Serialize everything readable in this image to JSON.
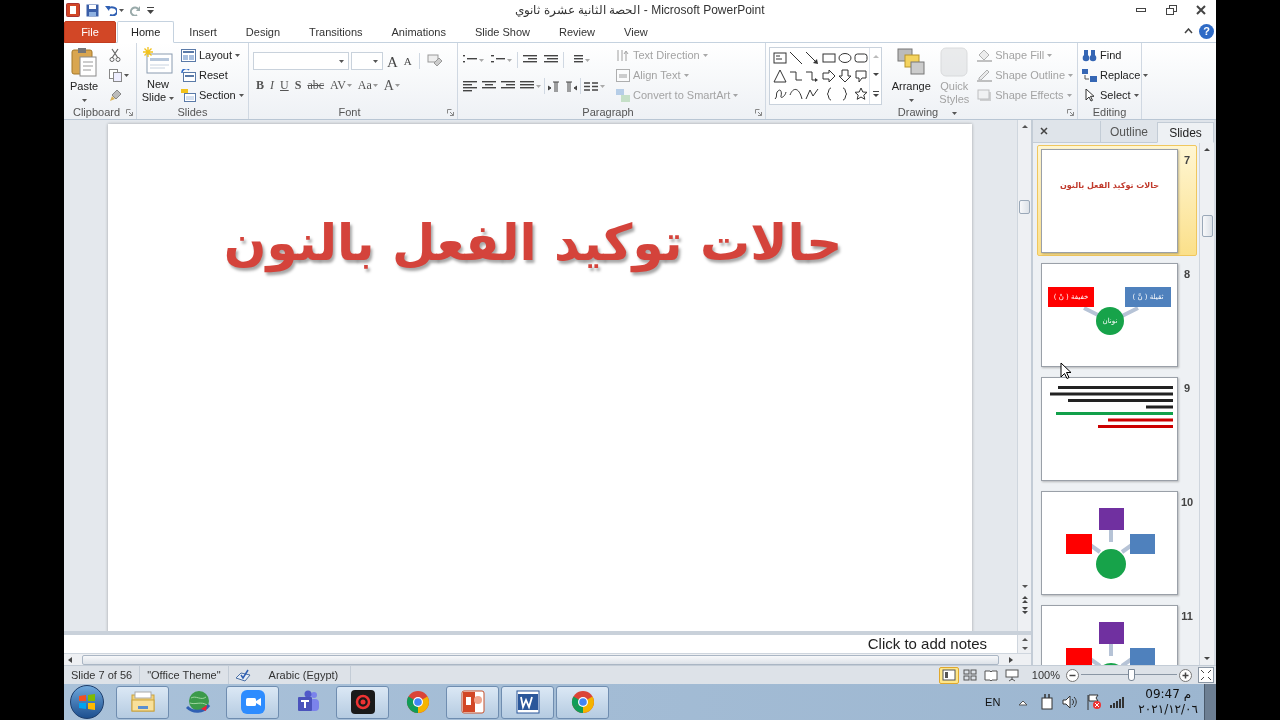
{
  "window": {
    "title": "الحصة الثانية عشرة ثانوي  -  Microsoft PowerPoint"
  },
  "ribbon_tabs": [
    {
      "label": "File",
      "kind": "file",
      "selected": false
    },
    {
      "label": "Home",
      "kind": "tab",
      "selected": true
    },
    {
      "label": "Insert",
      "kind": "tab",
      "selected": false
    },
    {
      "label": "Design",
      "kind": "tab",
      "selected": false
    },
    {
      "label": "Transitions",
      "kind": "tab",
      "selected": false
    },
    {
      "label": "Animations",
      "kind": "tab",
      "selected": false
    },
    {
      "label": "Slide Show",
      "kind": "tab",
      "selected": false
    },
    {
      "label": "Review",
      "kind": "tab",
      "selected": false
    },
    {
      "label": "View",
      "kind": "tab",
      "selected": false
    }
  ],
  "help": "?",
  "ribbon_groups": [
    {
      "label": "Clipboard",
      "commands": [
        {
          "label": "Paste",
          "dropdown": true,
          "disabled": false
        }
      ]
    },
    {
      "label": "Slides",
      "commands": [
        {
          "label": "New Slide",
          "dropdown": true,
          "disabled": false
        },
        {
          "label": "Layout",
          "dropdown": true,
          "disabled": false
        },
        {
          "label": "Reset",
          "dropdown": false,
          "disabled": false
        },
        {
          "label": "Section",
          "dropdown": true,
          "disabled": false
        }
      ]
    },
    {
      "label": "Font",
      "grow_shrink": [
        "A",
        "A"
      ],
      "format_buttons": [
        "B",
        "I",
        "U",
        "S",
        "abc",
        "AV",
        "Aa",
        "A"
      ]
    },
    {
      "label": "Paragraph",
      "commands": [
        {
          "label": "Text Direction",
          "dropdown": true,
          "disabled": true
        },
        {
          "label": "Align Text",
          "dropdown": true,
          "disabled": true
        },
        {
          "label": "Convert to SmartArt",
          "dropdown": true,
          "disabled": true
        }
      ]
    },
    {
      "label": "Drawing",
      "commands": [
        {
          "label": "Arrange",
          "dropdown": true,
          "disabled": false
        },
        {
          "label": "Quick Styles",
          "dropdown": true,
          "disabled": true
        },
        {
          "label": "Shape Fill",
          "dropdown": true,
          "disabled": true
        },
        {
          "label": "Shape Outline",
          "dropdown": true,
          "disabled": true
        },
        {
          "label": "Shape Effects",
          "dropdown": true,
          "disabled": true
        }
      ]
    },
    {
      "label": "Editing",
      "commands": [
        {
          "label": "Find",
          "dropdown": false,
          "disabled": false
        },
        {
          "label": "Replace",
          "dropdown": true,
          "disabled": false
        },
        {
          "label": "Select",
          "dropdown": true,
          "disabled": false
        }
      ]
    }
  ],
  "slide_editor": {
    "title": "حالات توكيد الفعل بالنون",
    "notes_placeholder": "Click to add notes"
  },
  "slides_panel": {
    "tabs": [
      {
        "label": "Outline",
        "selected": false
      },
      {
        "label": "Slides",
        "selected": true
      }
    ],
    "thumbnails": [
      {
        "number": "7",
        "selected": true,
        "kind": "title",
        "title": "حالات توكيد الفعل بالنون"
      },
      {
        "number": "8",
        "selected": false,
        "kind": "labeled-diagram",
        "labels": [
          "ثقيلة ( نَّ )",
          "خفيفة ( نْ )",
          "نونان"
        ]
      },
      {
        "number": "9",
        "selected": false,
        "kind": "text-lines"
      },
      {
        "number": "10",
        "selected": false,
        "kind": "diagram"
      },
      {
        "number": "11",
        "selected": false,
        "kind": "diagram"
      }
    ]
  },
  "status_bar": {
    "slide_info": "Slide 7 of 56",
    "theme": "\"Office Theme\"",
    "language": "Arabic (Egypt)",
    "views": [
      {
        "kind": "normal",
        "selected": true
      },
      {
        "kind": "sorter",
        "selected": false
      },
      {
        "kind": "reading",
        "selected": false
      },
      {
        "kind": "slideshow",
        "selected": false
      }
    ],
    "zoom": "100%",
    "zoom_slider": {
      "level": 0.52
    }
  },
  "taskbar": {
    "apps": [
      {
        "kind": "explorer",
        "running": true
      },
      {
        "kind": "download-manager",
        "running": false
      },
      {
        "kind": "zoom",
        "running": true
      },
      {
        "kind": "teams",
        "running": false
      },
      {
        "kind": "recorder",
        "running": true
      },
      {
        "kind": "chrome",
        "running": false
      },
      {
        "kind": "powerpoint",
        "running": true
      },
      {
        "kind": "word",
        "running": true
      },
      {
        "kind": "chrome",
        "running": true
      }
    ],
    "language": "EN",
    "time": "09:47 م",
    "date": "٢٠٢١/١٢/٠٦"
  }
}
